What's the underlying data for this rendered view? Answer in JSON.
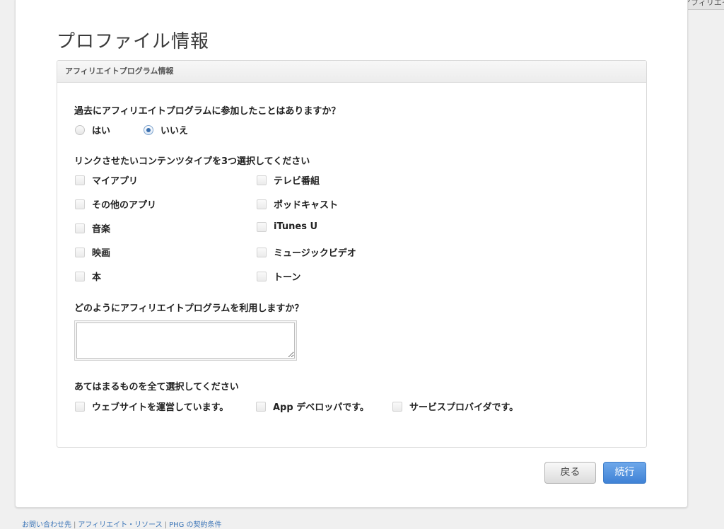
{
  "corner_tab": "iTunes アフィリエイ",
  "page_title": "プロファイル情報",
  "panel_title": "アフィリエイトプログラム情報",
  "q1": {
    "label": "過去にアフィリエイトプログラムに参加したことはありますか？",
    "options": [
      "はい",
      "いいえ"
    ],
    "selected": "いいえ"
  },
  "q2": {
    "label": "リンクさせたいコンテンツタイプを3つ選択してください",
    "left": [
      "マイアプリ",
      "その他のアプリ",
      "音楽",
      "映画",
      "本"
    ],
    "right": [
      "テレビ番組",
      "ポッドキャスト",
      "iTunes U",
      "ミュージックビデオ",
      "トーン"
    ]
  },
  "q3": {
    "label": "どのようにアフィリエイトプログラムを利用しますか？",
    "value": ""
  },
  "q4": {
    "label": "あてはまるものを全て選択してください",
    "options": [
      "ウェブサイトを運営しています。",
      "App デベロッパです。",
      "サービスプロバイダです。"
    ]
  },
  "buttons": {
    "back": "戻る",
    "continue": "続行"
  },
  "footer": {
    "links": [
      "お問い合わせ先",
      "アフィリエイト・リソース",
      "PHG の契約条件"
    ],
    "separator": "|"
  }
}
